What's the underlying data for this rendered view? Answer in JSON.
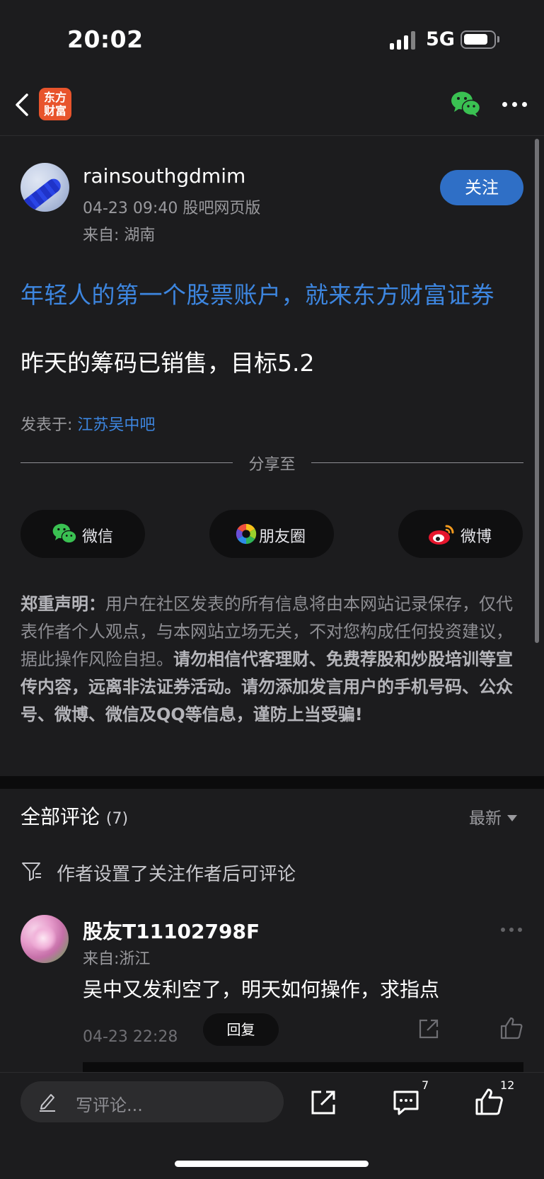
{
  "status": {
    "time": "20:02",
    "network": "5G"
  },
  "nav": {
    "logo_text_line1": "东方",
    "logo_text_line2": "财富"
  },
  "post": {
    "author": "rainsouthgdmim",
    "meta": "04-23 09:40 股吧网页版",
    "location": "来自: 湖南",
    "follow_label": "关注",
    "promo": "年轻人的第一个股票账户，就来东方财富证券",
    "title": "昨天的筹码已销售，目标5.2",
    "posted_in_label": "发表于: ",
    "forum": "江苏吴中吧"
  },
  "share": {
    "label": "分享至",
    "buttons": [
      {
        "label": "微信",
        "icon": "wechat-icon"
      },
      {
        "label": "朋友圈",
        "icon": "moments-icon"
      },
      {
        "label": "微博",
        "icon": "weibo-icon"
      }
    ]
  },
  "disclaimer": {
    "heading": "郑重声明：",
    "normal": "用户在社区发表的所有信息将由本网站记录保存，仅代表作者个人观点，与本网站立场无关，不对您构成任何投资建议，据此操作风险自担。",
    "bold": "请勿相信代客理财、免费荐股和炒股培训等宣传内容，远离非法证券活动。请勿添加发言用户的手机号码、公众号、微博、微信及QQ等信息，谨防上当受骗!"
  },
  "comments": {
    "title": "全部评论",
    "count": "(7)",
    "sort": "最新",
    "filter_notice": "作者设置了关注作者后可评论",
    "items": [
      {
        "user": "股友T11102798F",
        "location": "来自:浙江",
        "text": "吴中又发利空了，明天如何操作，求指点",
        "time": "04-23 22:28",
        "reply_label": "回复"
      }
    ]
  },
  "bottom_bar": {
    "input_placeholder": "写评论...",
    "comment_count": "7",
    "like_count": "12"
  },
  "colors": {
    "background": "#1c1c1e",
    "accent_blue": "#2f6fc6",
    "link_blue": "#3d86e0",
    "brand_orange": "#e8542c",
    "wechat_green": "#3ac152"
  }
}
